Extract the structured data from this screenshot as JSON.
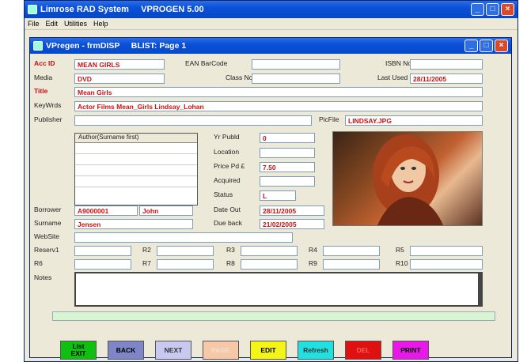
{
  "app": {
    "title": "Limrose RAD System     VPROGEN 5.00"
  },
  "menu": [
    "File",
    "Edit",
    "Utilities",
    "Help"
  ],
  "form": {
    "title": "VPregen - frmDISP     BLIST: Page 1"
  },
  "labels": {
    "acc_id": "Acc ID",
    "ean": "EAN BarCode",
    "isbn": "ISBN No",
    "media": "Media",
    "class_no": "Class No",
    "last_used": "Last Used",
    "title": "Title",
    "keywords": "KeyWrds",
    "publisher": "Publisher",
    "picfile": "PicFile",
    "author_header": "Author(Surname first)",
    "yr_publd": "Yr Publd",
    "location": "Location",
    "price": "Price Pd £",
    "acquired": "Acquired",
    "status": "Status",
    "borrower": "Borrower",
    "surname": "Surname",
    "date_out": "Date Out",
    "due_back": "Due back",
    "website": "WebSite",
    "reserv1": "Reserv1",
    "r2": "R2",
    "r3": "R3",
    "r4": "R4",
    "r5": "R5",
    "r6": "R6",
    "r7": "R7",
    "r8": "R8",
    "r9": "R9",
    "r10": "R10",
    "notes": "Notes"
  },
  "values": {
    "acc_id": "MEAN GIRLS",
    "ean": "",
    "isbn": "",
    "media": "DVD",
    "class_no": "",
    "last_used": "28/11/2005",
    "title": "Mean Girls",
    "keywords": "Actor Films Mean_Girls Lindsay_Lohan",
    "publisher": "",
    "picfile": "LINDSAY.JPG",
    "yr_publd": "0",
    "location": "",
    "price": "7.50",
    "acquired": "",
    "status": "L",
    "borrower_id": "A9000001",
    "borrower_first": "John",
    "surname": "Jensen",
    "date_out": "28/11/2005",
    "due_back": "21/02/2005",
    "website": ""
  },
  "buttons": [
    {
      "id": "list-exit",
      "label": "List\nEXIT",
      "bg": "#10c010",
      "fg": "#000"
    },
    {
      "id": "back",
      "label": "BACK",
      "bg": "#7f86c8",
      "fg": "#000"
    },
    {
      "id": "next",
      "label": "NEXT",
      "bg": "#c8c8f0",
      "fg": "#333"
    },
    {
      "id": "page",
      "label": "PAGE",
      "bg": "#f6c8a8",
      "fg": "#f0e0d0"
    },
    {
      "id": "edit",
      "label": "EDIT",
      "bg": "#f4f418",
      "fg": "#000"
    },
    {
      "id": "refresh",
      "label": "Refresh",
      "bg": "#20e0e0",
      "fg": "#333"
    },
    {
      "id": "del",
      "label": "DEL",
      "bg": "#e01010",
      "fg": "#ff6060"
    },
    {
      "id": "print",
      "label": "PRINT",
      "bg": "#e818e8",
      "fg": "#000"
    }
  ]
}
